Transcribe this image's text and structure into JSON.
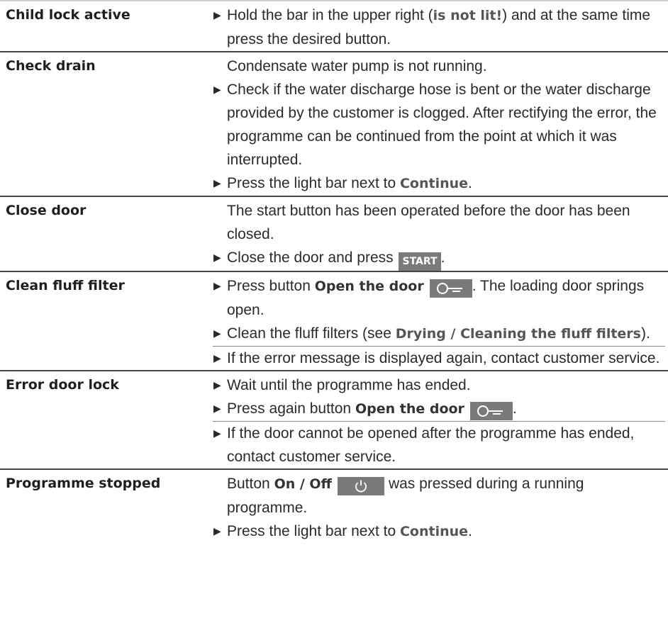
{
  "rows": [
    {
      "message": "Child lock active",
      "remedy": {
        "p1": {
          "t1": "Hold the bar in the upper right (",
          "bold": "is not lit!",
          "t2": ") and at the same time press the desired button."
        }
      }
    },
    {
      "message": "Check drain",
      "remedy": {
        "p1": "Condensate water pump is not running.",
        "p2": "Check if the water discharge hose is bent or the water discharge provided by the customer is clogged. After rectifying the error, the programme can be continued from the point at which it was interrupted.",
        "p3": {
          "t1": "Press the light bar next to ",
          "bold": "Continue",
          "t2": "."
        }
      }
    },
    {
      "message": "Close door",
      "remedy": {
        "p1": "The start button has been operated before the door has been closed.",
        "p2": {
          "t1": "Close the door and press ",
          "badge": "START",
          "t2": "."
        }
      }
    },
    {
      "message": "Clean fluff filter",
      "remedy": {
        "p1": {
          "t1": "Press button ",
          "bold": "Open the door",
          "t2": ". The loading door springs open."
        },
        "p2": {
          "t1": "Clean the fluff filters (see ",
          "bold": "Drying / Cleaning the fluff filters",
          "t2": ")."
        },
        "p3": "If the error message is displayed again, contact customer service."
      }
    },
    {
      "message": "Error door lock",
      "remedy": {
        "p1": "Wait until the programme has ended.",
        "p2": {
          "t1": "Press again button ",
          "bold": "Open the door",
          "t2": "."
        },
        "p3": "If the door cannot be opened after the programme has ended, contact customer service."
      }
    },
    {
      "message": "Programme stopped",
      "remedy": {
        "p1": {
          "t1": "Button ",
          "bold": "On / Off",
          "t2": "was pressed during a running programme."
        },
        "p2": {
          "t1": "Press the light bar next to ",
          "bold": "Continue",
          "t2": "."
        }
      }
    }
  ],
  "icons": {
    "bullet": "arrow-bullet-icon",
    "door": "open-door-key-icon",
    "power": "power-icon"
  },
  "colors": {
    "badge_bg": "#7a7a7a",
    "bold_text": "#555555",
    "rule": "#444444"
  }
}
